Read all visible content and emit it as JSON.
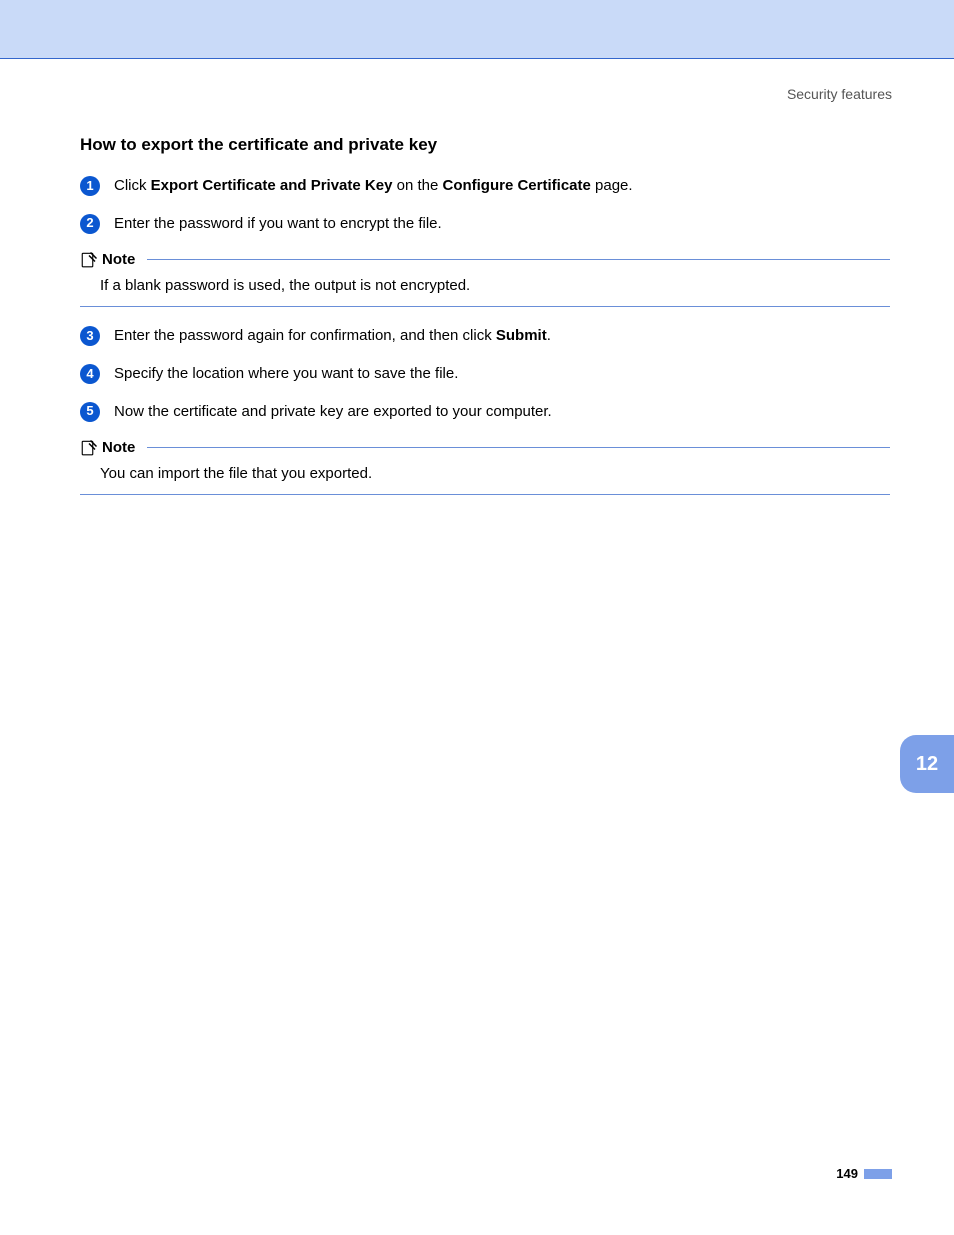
{
  "header": {
    "running_title": "Security features"
  },
  "section": {
    "title": "How to export the certificate and private key"
  },
  "steps": [
    {
      "num": "1",
      "pre": "Click ",
      "bold1": "Export Certificate and Private Key",
      "mid": " on the ",
      "bold2": "Configure Certificate",
      "post": " page."
    },
    {
      "num": "2",
      "pre": "Enter the password if you want to encrypt the file.",
      "bold1": "",
      "mid": "",
      "bold2": "",
      "post": ""
    },
    {
      "num": "3",
      "pre": "Enter the password again for confirmation, and then click ",
      "bold1": "Submit",
      "mid": ".",
      "bold2": "",
      "post": ""
    },
    {
      "num": "4",
      "pre": "Specify the location where you want to save the file.",
      "bold1": "",
      "mid": "",
      "bold2": "",
      "post": ""
    },
    {
      "num": "5",
      "pre": "Now the certificate and private key are exported to your computer.",
      "bold1": "",
      "mid": "",
      "bold2": "",
      "post": ""
    }
  ],
  "notes": [
    {
      "label": "Note",
      "body": "If a blank password is used, the output is not encrypted."
    },
    {
      "label": "Note",
      "body": "You can import the file that you exported."
    }
  ],
  "chapter_tab": "12",
  "page_number": "149"
}
